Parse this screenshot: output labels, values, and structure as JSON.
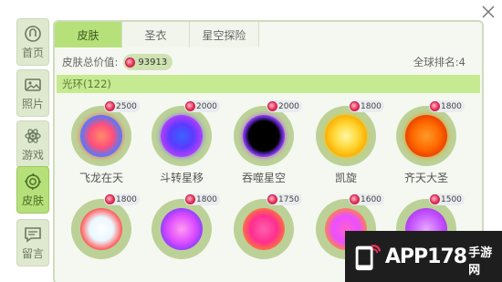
{
  "sidebar": {
    "items": [
      {
        "label": "首页",
        "icon": "home-icon",
        "active": false
      },
      {
        "label": "照片",
        "icon": "photo-icon",
        "active": false
      },
      {
        "label": "游戏",
        "icon": "game-icon",
        "active": false
      },
      {
        "label": "皮肤",
        "icon": "skin-icon",
        "active": true
      },
      {
        "label": "留言",
        "icon": "message-icon",
        "active": false
      }
    ]
  },
  "tabs": [
    {
      "label": "皮肤",
      "active": true
    },
    {
      "label": "圣衣",
      "active": false
    },
    {
      "label": "星空探险",
      "active": false
    }
  ],
  "summary": {
    "value_label": "皮肤总价值:",
    "value": "93913",
    "rank_label": "全球排名:4"
  },
  "category": {
    "label": "光环(122)"
  },
  "skins": [
    {
      "name": "飞龙在天",
      "price": "2500"
    },
    {
      "name": "斗转星移",
      "price": "2000"
    },
    {
      "name": "吞噬星空",
      "price": "2000"
    },
    {
      "name": "凯旋",
      "price": "1800"
    },
    {
      "name": "齐天大圣",
      "price": "1800"
    },
    {
      "name": "",
      "price": "1800"
    },
    {
      "name": "",
      "price": "1800"
    },
    {
      "name": "",
      "price": "1750"
    },
    {
      "name": "",
      "price": "1600"
    },
    {
      "name": "",
      "price": "1500"
    }
  ],
  "watermark": {
    "text": "APP178",
    "sub": "手游网"
  }
}
